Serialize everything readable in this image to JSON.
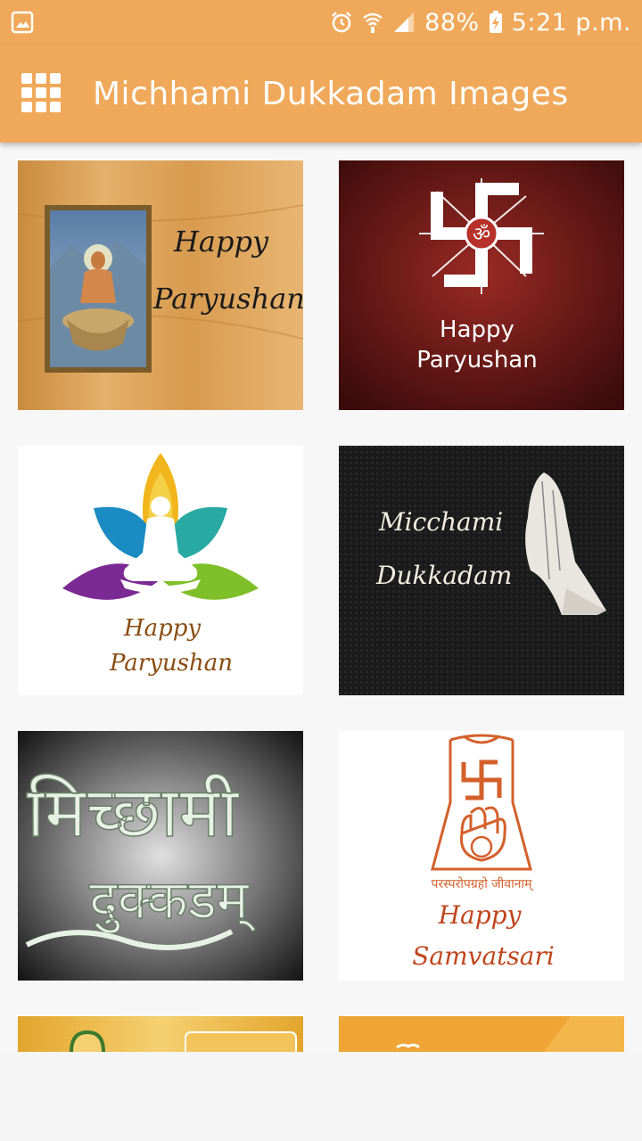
{
  "status_bar": {
    "battery": "88%",
    "time": "5:21 p.m."
  },
  "app_bar": {
    "title": "Michhami Dukkadam Images",
    "menu_icon": "grid-menu-icon"
  },
  "images": [
    {
      "line1": "Happy",
      "line2": "Paryushan"
    },
    {
      "line1": "Happy",
      "line2": "Paryushan"
    },
    {
      "line1": "Happy",
      "line2": "Paryushan"
    },
    {
      "line1": "Micchami",
      "line2": "Dukkadam"
    },
    {
      "line1": "मिच्छामी",
      "line2": "दुक्कडम्"
    },
    {
      "line1": "Happy",
      "line2": "Samvatsari",
      "caption": "परस्परोपग्रहो जीवानाम्"
    }
  ],
  "colors": {
    "accent": "#f0a95a",
    "background": "#f7f7f7"
  }
}
